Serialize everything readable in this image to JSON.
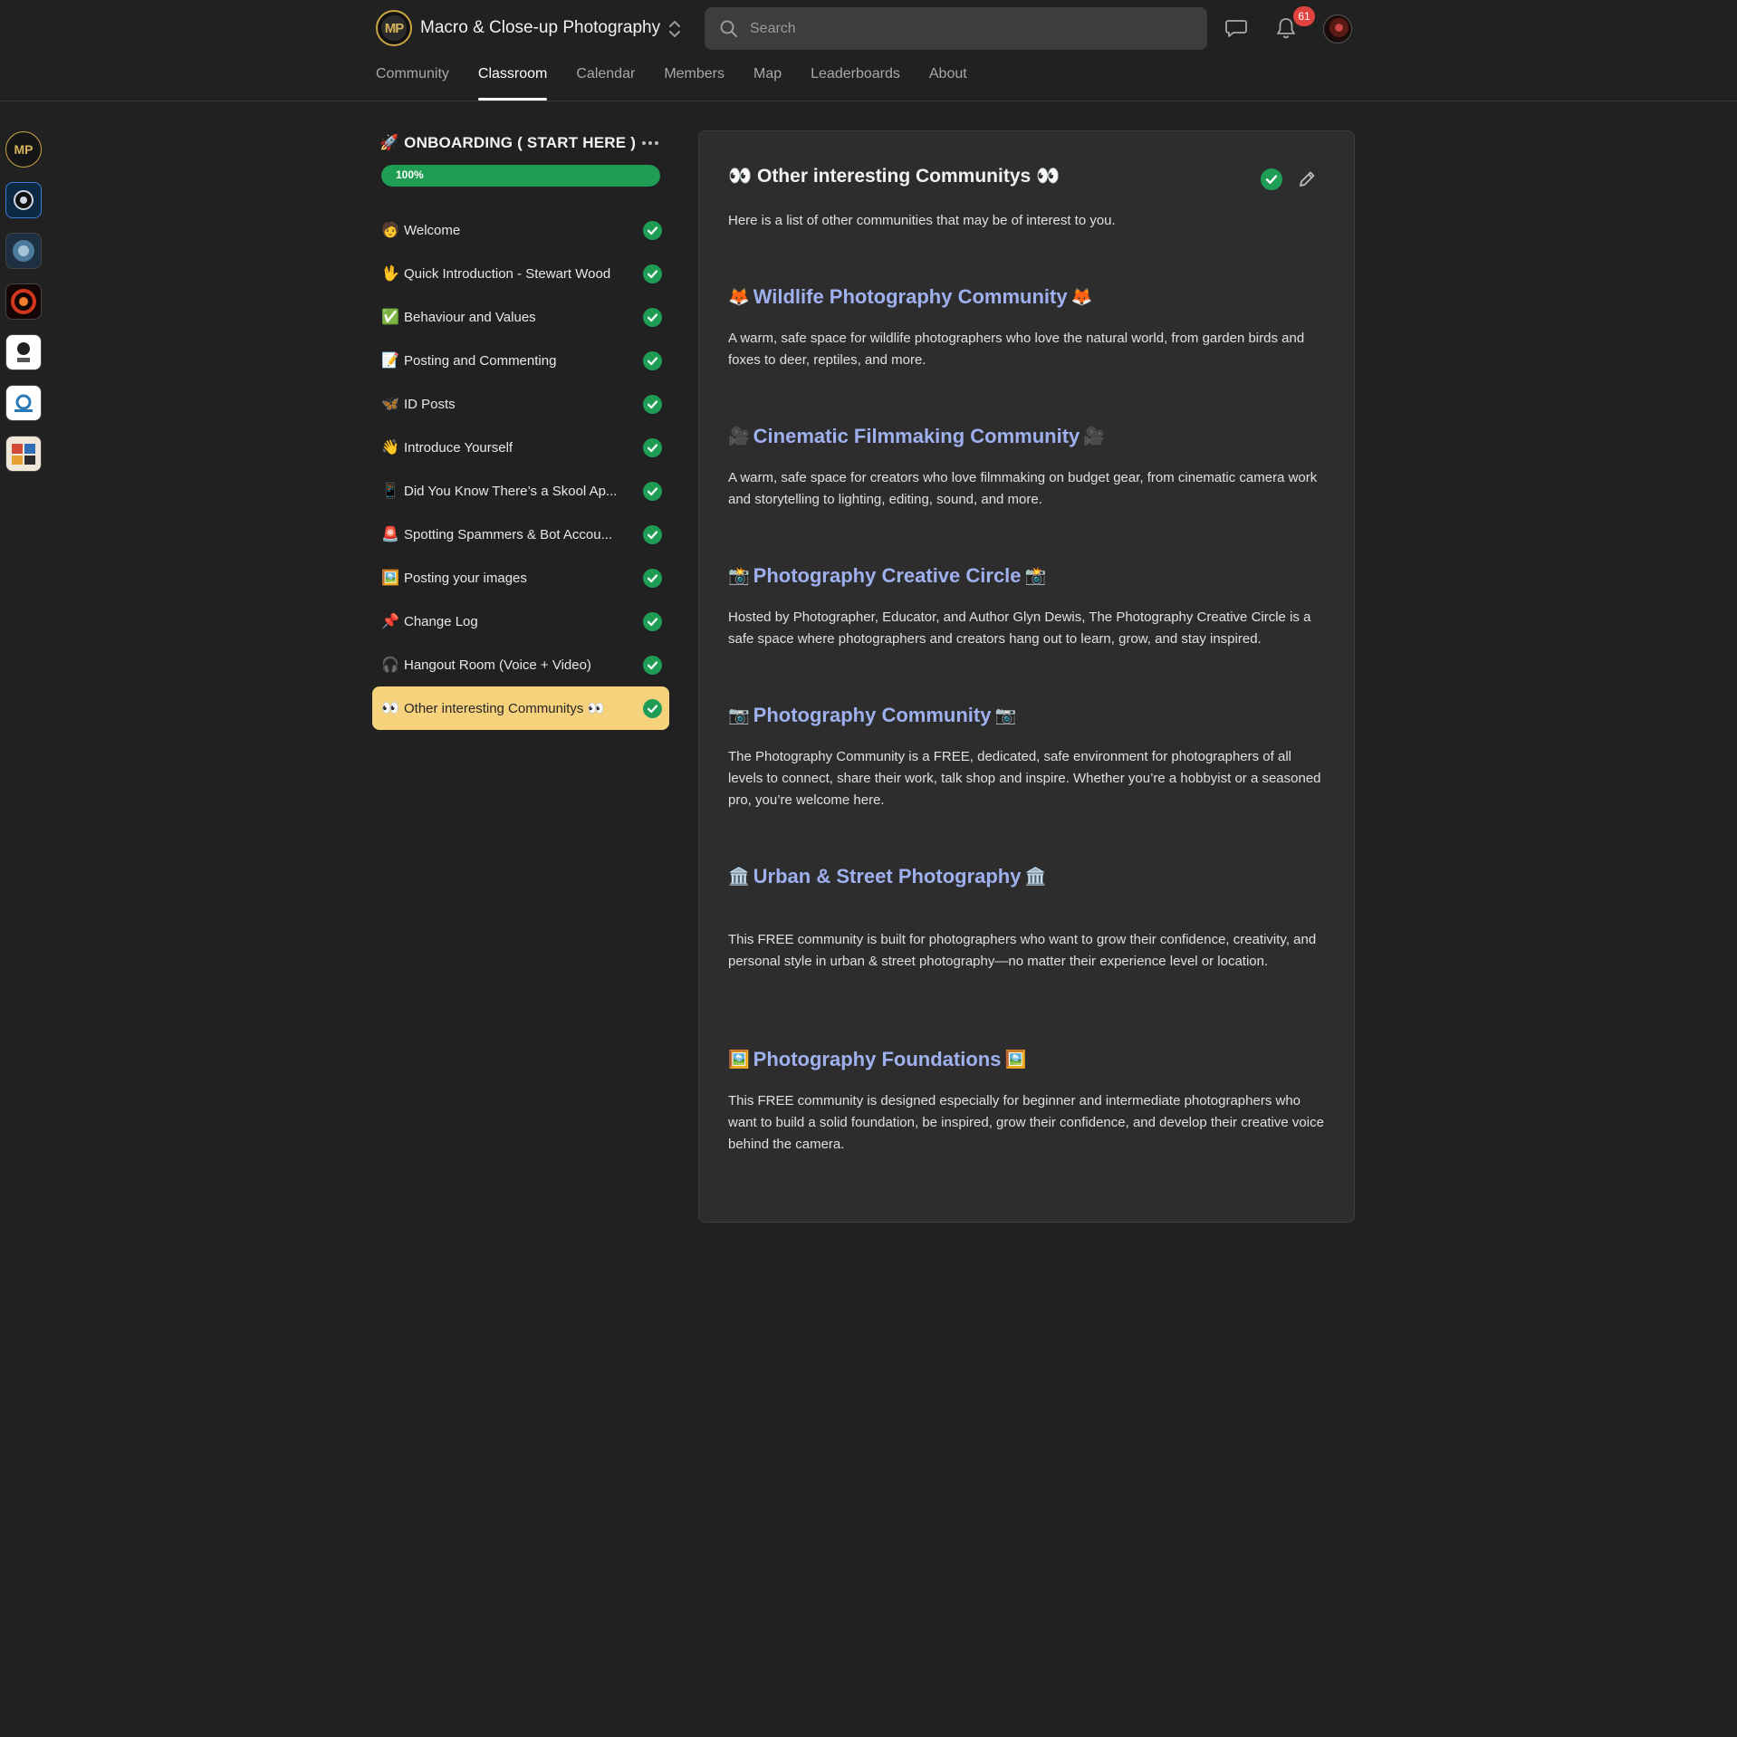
{
  "header": {
    "community_name": "Macro & Close-up Photography",
    "logo_text": "MP",
    "search_placeholder": "Search",
    "notification_count": "61"
  },
  "tabs": [
    {
      "label": "Community",
      "active": false
    },
    {
      "label": "Classroom",
      "active": true
    },
    {
      "label": "Calendar",
      "active": false
    },
    {
      "label": "Members",
      "active": false
    },
    {
      "label": "Map",
      "active": false
    },
    {
      "label": "Leaderboards",
      "active": false
    },
    {
      "label": "About",
      "active": false
    }
  ],
  "rail": {
    "items": [
      "community-icon-macro",
      "community-icon-2",
      "community-icon-3",
      "community-icon-4",
      "community-icon-5",
      "community-icon-6",
      "community-icon-7"
    ]
  },
  "course": {
    "title_emoji": "🚀",
    "title": "ONBOARDING ( START HERE )",
    "progress_label": "100%",
    "progress_fraction": 1.0,
    "lessons": [
      {
        "emoji": "🧑",
        "label": "Welcome"
      },
      {
        "emoji": "🖖",
        "label": "Quick Introduction - Stewart Wood"
      },
      {
        "emoji": "✅",
        "label": "Behaviour and Values"
      },
      {
        "emoji": "📝",
        "label": "Posting and Commenting"
      },
      {
        "emoji": "🦋",
        "label": "ID Posts"
      },
      {
        "emoji": "👋",
        "label": "Introduce Yourself"
      },
      {
        "emoji": "📱",
        "label": "Did You Know There’s a Skool Ap..."
      },
      {
        "emoji": "🚨",
        "label": "Spotting Spammers & Bot Accou..."
      },
      {
        "emoji": "🖼️",
        "label": "Posting your images"
      },
      {
        "emoji": "📌",
        "label": "Change Log"
      },
      {
        "emoji": "🎧",
        "label": "Hangout Room (Voice + Video)"
      },
      {
        "emoji": "👀",
        "label": "Other interesting Communitys 👀"
      }
    ]
  },
  "colors": {
    "background": "#212121",
    "panel": "#2d2d2d",
    "accent_green": "#1f9d55",
    "active_lesson": "#f7d27c",
    "link_blue": "#9fb0ef",
    "badge_red": "#e0433f"
  },
  "content": {
    "title": "👀 Other interesting Communitys 👀",
    "intro": "Here is a list of other communities that may be of interest to you.",
    "entries": [
      {
        "emoji": "🦊",
        "title": "Wildlife Photography Community",
        "description": "A warm, safe space for wildlife photographers who love the natural world, from garden birds and foxes to deer, reptiles, and more."
      },
      {
        "emoji": "🎥",
        "title": "Cinematic Filmmaking Community",
        "description": "A warm, safe space for creators who love filmmaking on budget gear, from cinematic camera work and storytelling to lighting, editing, sound, and more."
      },
      {
        "emoji": "📸",
        "title": "Photography Creative Circle",
        "description": "Hosted by Photographer, Educator, and Author Glyn Dewis, The Photography Creative Circle is a safe space where photographers and creators hang out to learn, grow, and stay inspired."
      },
      {
        "emoji": "📷",
        "title": "Photography Community",
        "description": "The Photography Community is a FREE, dedicated, safe environment for photographers of all levels to connect, share their work, talk shop and inspire. Whether you’re a hobbyist or a seasoned pro, you’re welcome here."
      },
      {
        "emoji": "🏛️",
        "title": "Urban & Street Photography",
        "description": "This FREE community is built for photographers who want to grow their confidence, creativity, and personal style in urban & street photography—no matter their experience level or location."
      },
      {
        "emoji": "🖼️",
        "title": "Photography Foundations",
        "description": "This FREE community is designed especially for beginner and intermediate photographers who want to build a solid foundation, be inspired, grow their confidence, and develop their creative voice behind the camera."
      }
    ]
  }
}
